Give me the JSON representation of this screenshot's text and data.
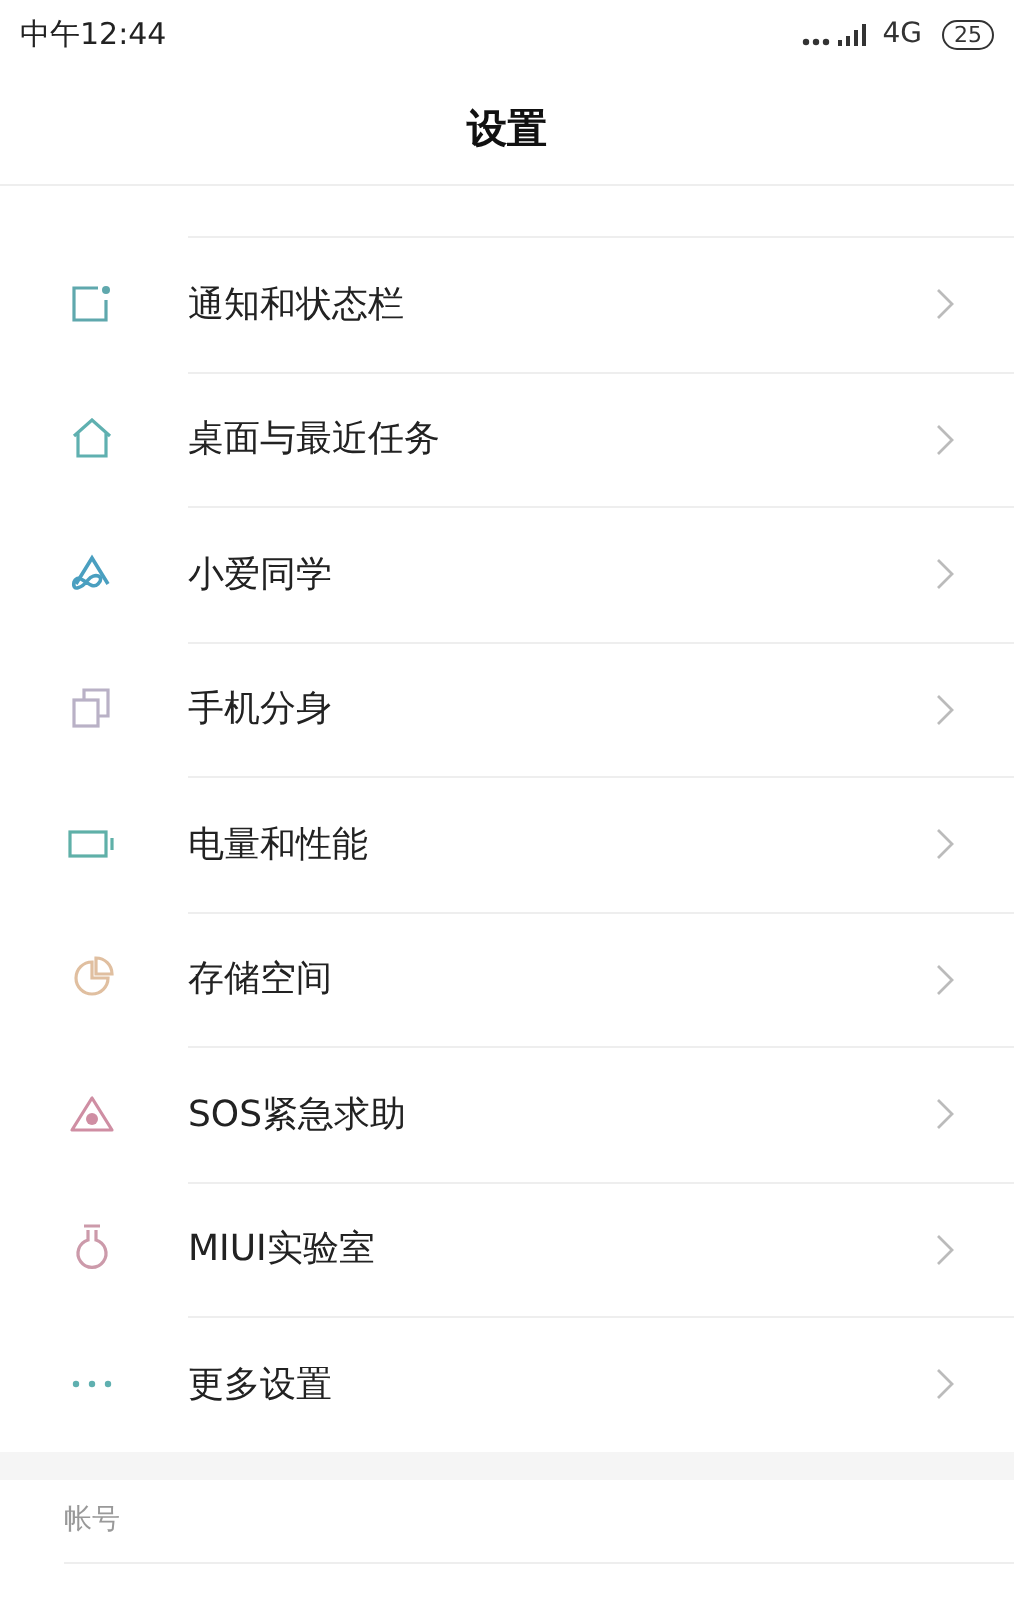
{
  "status_bar": {
    "time": "中午12:44",
    "network": "4G",
    "battery": "25"
  },
  "title": "设置",
  "items": [
    {
      "label": "通知和状态栏"
    },
    {
      "label": "桌面与最近任务"
    },
    {
      "label": "小爱同学"
    },
    {
      "label": "手机分身"
    },
    {
      "label": "电量和性能"
    },
    {
      "label": "存储空间"
    },
    {
      "label": "SOS紧急求助"
    },
    {
      "label": "MIUI实验室"
    },
    {
      "label": "更多设置"
    }
  ],
  "section_header": "帐号"
}
